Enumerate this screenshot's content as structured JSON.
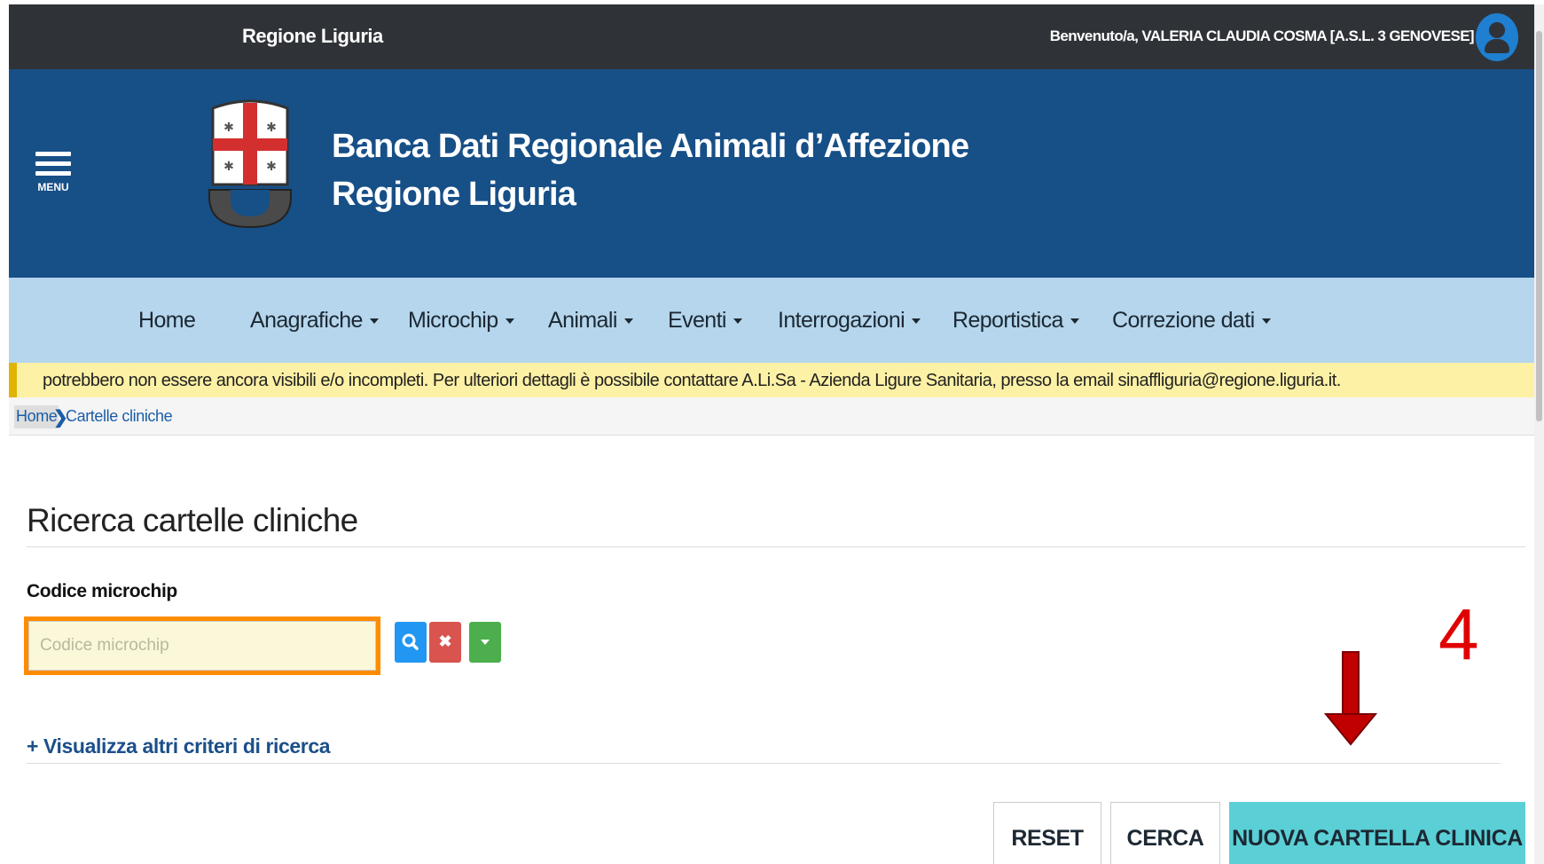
{
  "topbar": {
    "region": "Regione Liguria",
    "welcome": "Benvenuto/a, VALERIA CLAUDIA COSMA [A.S.L. 3 GENOVESE]"
  },
  "header": {
    "menu_label": "MENU",
    "title_line1": "Banca Dati Regionale Animali d’Affezione",
    "title_line2": "Regione Liguria"
  },
  "nav": {
    "items": [
      {
        "label": "Home",
        "dropdown": false
      },
      {
        "label": "Anagrafiche",
        "dropdown": true
      },
      {
        "label": "Microchip",
        "dropdown": true
      },
      {
        "label": "Animali",
        "dropdown": true
      },
      {
        "label": "Eventi",
        "dropdown": true
      },
      {
        "label": "Interrogazioni",
        "dropdown": true
      },
      {
        "label": "Reportistica",
        "dropdown": true
      },
      {
        "label": "Correzione dati",
        "dropdown": true
      }
    ]
  },
  "notice": {
    "text": "potrebbero non essere ancora visibili e/o incompleti. Per ulteriori dettagli è possibile contattare A.Li.Sa - Azienda Ligure Sanitaria, presso la email sinaffliguria@regione.liguria.it."
  },
  "breadcrumb": {
    "home": "Home",
    "current": "Cartelle cliniche"
  },
  "main": {
    "title": "Ricerca cartelle cliniche",
    "field_label": "Codice microchip",
    "field_value": "",
    "field_placeholder": "Codice microchip",
    "more_criteria": "+ Visualizza altri criteri di ricerca",
    "buttons": {
      "reset": "RESET",
      "cerca": "CERCA",
      "nuova": "NUOVA CARTELLA CLINICA"
    }
  },
  "icons": {
    "search_button": "search-icon",
    "clear_button": "close-icon",
    "dropdown_button": "caret-down-icon",
    "avatar": "user-icon"
  },
  "annotation": {
    "step_number": "4"
  },
  "colors": {
    "topbar": "#2f3338",
    "header": "#174f87",
    "nav": "#b5d6ec",
    "notice": "#fdf1a5",
    "highlight": "#ff8c00",
    "primary_action": "#5bcfd6",
    "annotation": "#e00000"
  }
}
